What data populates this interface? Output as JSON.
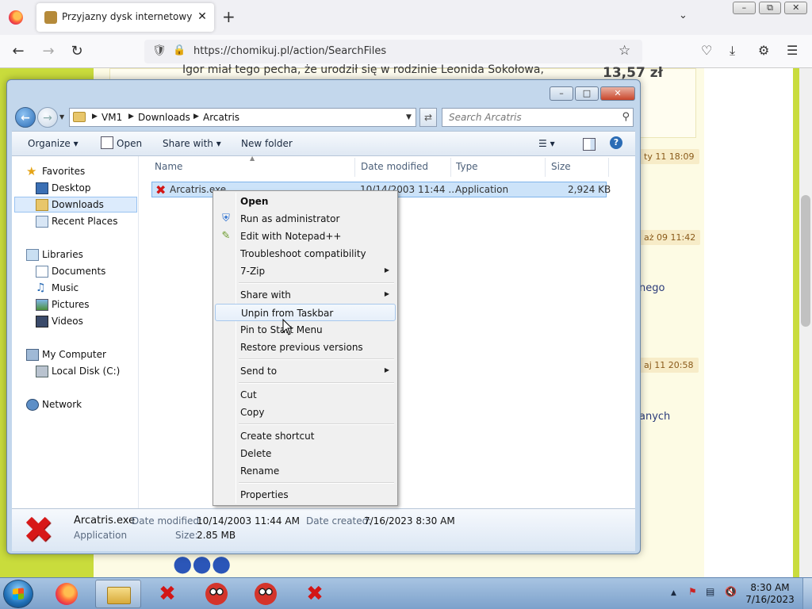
{
  "browser": {
    "tab_title": "Przyjazny dysk internetowy - Ch",
    "url": "https://chomikuj.pl/action/SearchFiles",
    "new_tab_symbol": "+",
    "close_tab_symbol": "✕"
  },
  "webpage": {
    "description": "Igor miał tego pecha, że urodził się w rodzinie Leonida Sokołowa,",
    "price": "13,57 zł",
    "dates": [
      "ty 11 18:09",
      "aż 09 11:42",
      "aj 11 20:58"
    ],
    "fragments": [
      "nego",
      "anych"
    ]
  },
  "explorer": {
    "breadcrumbs": [
      "VM1",
      "Downloads",
      "Arcatris"
    ],
    "search_placeholder": "Search Arcatris",
    "toolbar": {
      "organize": "Organize",
      "open": "Open",
      "share_with": "Share with",
      "new_folder": "New folder"
    },
    "nav": {
      "favorites": "Favorites",
      "desktop": "Desktop",
      "downloads": "Downloads",
      "recent_places": "Recent Places",
      "libraries": "Libraries",
      "documents": "Documents",
      "music": "Music",
      "pictures": "Pictures",
      "videos": "Videos",
      "my_computer": "My Computer",
      "local_disk": "Local Disk (C:)",
      "network": "Network"
    },
    "columns": {
      "name": "Name",
      "date_modified": "Date modified",
      "type": "Type",
      "size": "Size"
    },
    "file": {
      "name": "Arcatris.exe",
      "date_modified": "10/14/2003 11:44 ...",
      "type": "Application",
      "size": "2,924 KB"
    },
    "details": {
      "name": "Arcatris.exe",
      "type": "Application",
      "date_modified_label": "Date modified:",
      "date_modified": "10/14/2003 11:44 AM",
      "date_created_label": "Date created:",
      "date_created": "7/16/2023 8:30 AM",
      "size_label": "Size:",
      "size": "2.85 MB"
    }
  },
  "context_menu": {
    "open": "Open",
    "run_as_admin": "Run as administrator",
    "edit_notepad": "Edit with Notepad++",
    "troubleshoot": "Troubleshoot compatibility",
    "seven_zip": "7-Zip",
    "share_with": "Share with",
    "unpin_taskbar": "Unpin from Taskbar",
    "pin_start": "Pin to Start Menu",
    "restore_versions": "Restore previous versions",
    "send_to": "Send to",
    "cut": "Cut",
    "copy": "Copy",
    "create_shortcut": "Create shortcut",
    "delete": "Delete",
    "rename": "Rename",
    "properties": "Properties"
  },
  "taskbar": {
    "time": "8:30 AM",
    "date": "7/16/2023"
  },
  "colors": {
    "web_green": "#c9dc3c",
    "web_cream": "#fdfbe4",
    "selection": "#cce3f9",
    "app_red": "#d31616"
  }
}
